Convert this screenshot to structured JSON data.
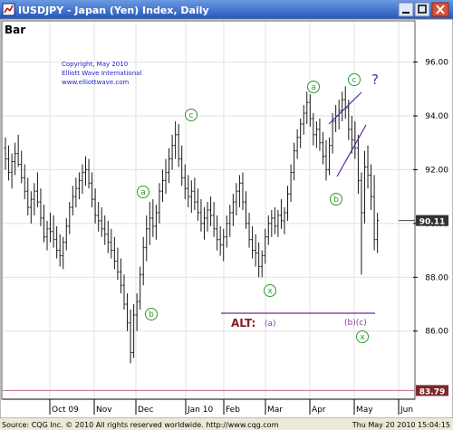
{
  "window": {
    "title": "IUSDJPY - Japan (Yen) Index, Daily",
    "minimize_glyph": "_",
    "maximize_glyph": "□",
    "close_glyph": "×"
  },
  "panel_label": "Bar",
  "copyright_block": {
    "line1": "Copyright, May 2010",
    "line2": "Elliott Wave International",
    "line3": "www.elliottwave.com"
  },
  "footer": {
    "source": "Source: CQG Inc. © 2010 All rights reserved worldwide. http://www.cqg.com",
    "timestamp": "Thu May 20 2010 15:04:15"
  },
  "colors": {
    "title_bar_top": "#5a88d8",
    "title_bar_bottom": "#2458c0",
    "price_bars": "#1a1a1a",
    "wave_labels": "#2e9a2e",
    "copyright_text": "#2222cc",
    "alt_line": "#6a2aa0",
    "alt_text": "#8a1a2a",
    "grid": "#e0e0e0",
    "current_price_bg": "#333333",
    "low_price_bg": "#7a2a2a"
  },
  "chart_data": {
    "type": "bar",
    "ylim": [
      83.5,
      97.5
    ],
    "yticks": [
      86.0,
      88.0,
      90.0,
      92.0,
      94.0,
      96.0
    ],
    "ytick_labels": [
      "86.00",
      "88.00",
      "90.00",
      "92.00",
      "94.00",
      "96.00"
    ],
    "x_months": [
      "Oct 09",
      "Nov",
      "Dec",
      "Jan 10",
      "Feb",
      "Mar",
      "Apr",
      "May",
      "Jun"
    ],
    "current_price_label": "90.11",
    "current_price": 90.11,
    "low_price_label": "83.79",
    "low_price": 83.79,
    "grid": true,
    "series": [
      {
        "ohlc_daily": [
          [
            92.8,
            93.2,
            92.0,
            92.4
          ],
          [
            92.4,
            92.9,
            91.6,
            91.9
          ],
          [
            91.9,
            92.6,
            91.3,
            92.3
          ],
          [
            92.3,
            93.0,
            91.8,
            92.6
          ],
          [
            92.6,
            93.3,
            92.1,
            92.2
          ],
          [
            92.2,
            92.7,
            91.5,
            91.7
          ],
          [
            91.7,
            92.2,
            90.9,
            91.2
          ],
          [
            91.2,
            91.7,
            90.3,
            90.6
          ],
          [
            90.6,
            91.2,
            90.0,
            90.9
          ],
          [
            90.9,
            91.5,
            90.3,
            91.2
          ],
          [
            91.2,
            91.9,
            90.6,
            90.8
          ],
          [
            90.8,
            91.3,
            89.9,
            90.2
          ],
          [
            90.2,
            90.7,
            89.3,
            89.5
          ],
          [
            89.5,
            90.1,
            89.0,
            89.8
          ],
          [
            89.8,
            90.4,
            89.3,
            89.7
          ],
          [
            89.7,
            90.3,
            89.1,
            89.4
          ],
          [
            89.4,
            89.9,
            88.7,
            89.0
          ],
          [
            89.0,
            89.6,
            88.4,
            88.8
          ],
          [
            88.8,
            89.5,
            88.3,
            89.3
          ],
          [
            89.3,
            90.2,
            89.0,
            89.9
          ],
          [
            89.9,
            90.8,
            89.6,
            90.6
          ],
          [
            90.6,
            91.4,
            90.3,
            91.0
          ],
          [
            91.0,
            91.7,
            90.6,
            91.3
          ],
          [
            91.3,
            91.9,
            90.9,
            91.6
          ],
          [
            91.6,
            92.2,
            91.1,
            91.9
          ],
          [
            91.9,
            92.5,
            91.4,
            92.0
          ],
          [
            92.0,
            92.4,
            91.3,
            91.5
          ],
          [
            91.5,
            91.9,
            90.6,
            90.9
          ],
          [
            90.9,
            91.3,
            90.0,
            90.3
          ],
          [
            90.3,
            90.8,
            89.7,
            90.1
          ],
          [
            90.1,
            90.6,
            89.5,
            89.8
          ],
          [
            89.8,
            90.3,
            89.2,
            89.6
          ],
          [
            89.6,
            90.1,
            88.9,
            89.3
          ],
          [
            89.3,
            89.8,
            88.7,
            89.0
          ],
          [
            89.0,
            89.5,
            88.3,
            88.6
          ],
          [
            88.6,
            89.1,
            87.9,
            88.2
          ],
          [
            88.2,
            88.7,
            87.4,
            87.7
          ],
          [
            87.7,
            88.1,
            86.8,
            87.0
          ],
          [
            87.0,
            87.4,
            86.0,
            86.3
          ],
          [
            86.3,
            86.8,
            84.8,
            85.2
          ],
          [
            85.2,
            87.0,
            85.0,
            86.6
          ],
          [
            86.6,
            87.4,
            86.0,
            87.1
          ],
          [
            87.1,
            88.4,
            86.8,
            88.1
          ],
          [
            88.1,
            89.5,
            87.7,
            89.1
          ],
          [
            89.1,
            90.3,
            88.6,
            89.8
          ],
          [
            89.8,
            90.8,
            89.2,
            90.2
          ],
          [
            90.2,
            90.9,
            89.5,
            89.9
          ],
          [
            89.9,
            90.7,
            89.4,
            90.4
          ],
          [
            90.4,
            91.5,
            90.0,
            91.2
          ],
          [
            91.2,
            92.0,
            90.8,
            91.6
          ],
          [
            91.6,
            92.4,
            91.1,
            91.9
          ],
          [
            91.9,
            92.8,
            91.5,
            92.4
          ],
          [
            92.4,
            93.3,
            92.0,
            92.9
          ],
          [
            92.9,
            93.8,
            92.4,
            93.3
          ],
          [
            93.3,
            93.7,
            92.1,
            92.4
          ],
          [
            92.4,
            92.9,
            91.4,
            91.7
          ],
          [
            91.7,
            92.2,
            90.9,
            91.3
          ],
          [
            91.3,
            91.8,
            90.6,
            91.0
          ],
          [
            91.0,
            91.6,
            90.4,
            91.2
          ],
          [
            91.2,
            91.7,
            90.5,
            90.8
          ],
          [
            90.8,
            91.3,
            90.1,
            90.4
          ],
          [
            90.4,
            90.9,
            89.7,
            90.0
          ],
          [
            90.0,
            90.6,
            89.4,
            90.2
          ],
          [
            90.2,
            90.8,
            89.7,
            90.5
          ],
          [
            90.5,
            91.0,
            89.9,
            90.3
          ],
          [
            90.3,
            90.8,
            89.5,
            89.8
          ],
          [
            89.8,
            90.3,
            89.0,
            89.4
          ],
          [
            89.4,
            89.9,
            88.8,
            89.2
          ],
          [
            89.2,
            89.8,
            88.6,
            89.5
          ],
          [
            89.5,
            90.3,
            89.1,
            90.0
          ],
          [
            90.0,
            90.7,
            89.5,
            90.4
          ],
          [
            90.4,
            91.1,
            89.9,
            90.8
          ],
          [
            90.8,
            91.5,
            90.3,
            91.2
          ],
          [
            91.2,
            91.8,
            90.6,
            91.5
          ],
          [
            91.5,
            91.9,
            90.5,
            90.8
          ],
          [
            90.8,
            91.2,
            89.8,
            90.0
          ],
          [
            90.0,
            90.4,
            89.1,
            89.4
          ],
          [
            89.4,
            89.9,
            88.7,
            89.0
          ],
          [
            89.0,
            89.6,
            88.4,
            88.9
          ],
          [
            88.9,
            89.3,
            88.0,
            88.4
          ],
          [
            88.4,
            89.0,
            88.0,
            88.8
          ],
          [
            88.8,
            89.8,
            88.5,
            89.5
          ],
          [
            89.5,
            90.3,
            89.2,
            90.0
          ],
          [
            90.0,
            90.5,
            89.5,
            90.2
          ],
          [
            90.2,
            90.6,
            89.6,
            89.9
          ],
          [
            89.9,
            90.5,
            89.5,
            90.3
          ],
          [
            90.3,
            90.9,
            89.8,
            90.1
          ],
          [
            90.1,
            90.6,
            89.6,
            90.4
          ],
          [
            90.4,
            91.4,
            90.1,
            91.1
          ],
          [
            91.1,
            92.2,
            90.8,
            91.9
          ],
          [
            91.9,
            93.0,
            91.6,
            92.7
          ],
          [
            92.7,
            93.5,
            92.4,
            93.2
          ],
          [
            93.2,
            93.9,
            92.8,
            93.7
          ],
          [
            93.7,
            94.4,
            93.3,
            94.1
          ],
          [
            94.1,
            94.9,
            93.7,
            94.5
          ],
          [
            94.5,
            94.8,
            93.6,
            93.9
          ],
          [
            93.9,
            94.1,
            92.9,
            93.3
          ],
          [
            93.3,
            93.8,
            92.8,
            93.5
          ],
          [
            93.5,
            93.9,
            92.7,
            93.0
          ],
          [
            93.0,
            93.4,
            92.2,
            92.5
          ],
          [
            92.5,
            93.1,
            91.6,
            92.0
          ],
          [
            92.0,
            93.2,
            91.8,
            92.9
          ],
          [
            92.9,
            94.1,
            92.6,
            93.8
          ],
          [
            93.8,
            94.4,
            93.4,
            94.0
          ],
          [
            94.0,
            94.6,
            93.5,
            94.2
          ],
          [
            94.2,
            94.9,
            93.8,
            94.6
          ],
          [
            94.6,
            95.1,
            93.9,
            94.3
          ],
          [
            94.3,
            94.6,
            93.1,
            93.5
          ],
          [
            93.5,
            94.0,
            92.6,
            93.1
          ],
          [
            93.1,
            93.8,
            92.4,
            92.8
          ],
          [
            92.8,
            93.3,
            91.1,
            91.6
          ],
          [
            91.6,
            91.9,
            88.1,
            90.4
          ],
          [
            90.4,
            92.7,
            90.0,
            92.1
          ],
          [
            92.1,
            92.9,
            91.3,
            91.8
          ],
          [
            91.8,
            92.2,
            90.5,
            91.0
          ],
          [
            91.0,
            91.8,
            89.0,
            89.4
          ],
          [
            89.4,
            90.4,
            88.9,
            90.11
          ]
        ]
      }
    ],
    "annotations": {
      "wave_labels": [
        {
          "text": "a",
          "circled": true
        },
        {
          "text": "b",
          "circled": true
        },
        {
          "text": "c",
          "circled": true
        },
        {
          "text": "x",
          "circled": true
        },
        {
          "text": "a",
          "circled": true
        },
        {
          "text": "b",
          "circled": true
        },
        {
          "text": "c",
          "circled": true
        },
        {
          "text": "x",
          "circled": true
        }
      ],
      "question_mark": "?",
      "alt": {
        "label": "ALT:",
        "wave_a": "(a)",
        "wave_bc": "(b)(c)"
      }
    }
  }
}
